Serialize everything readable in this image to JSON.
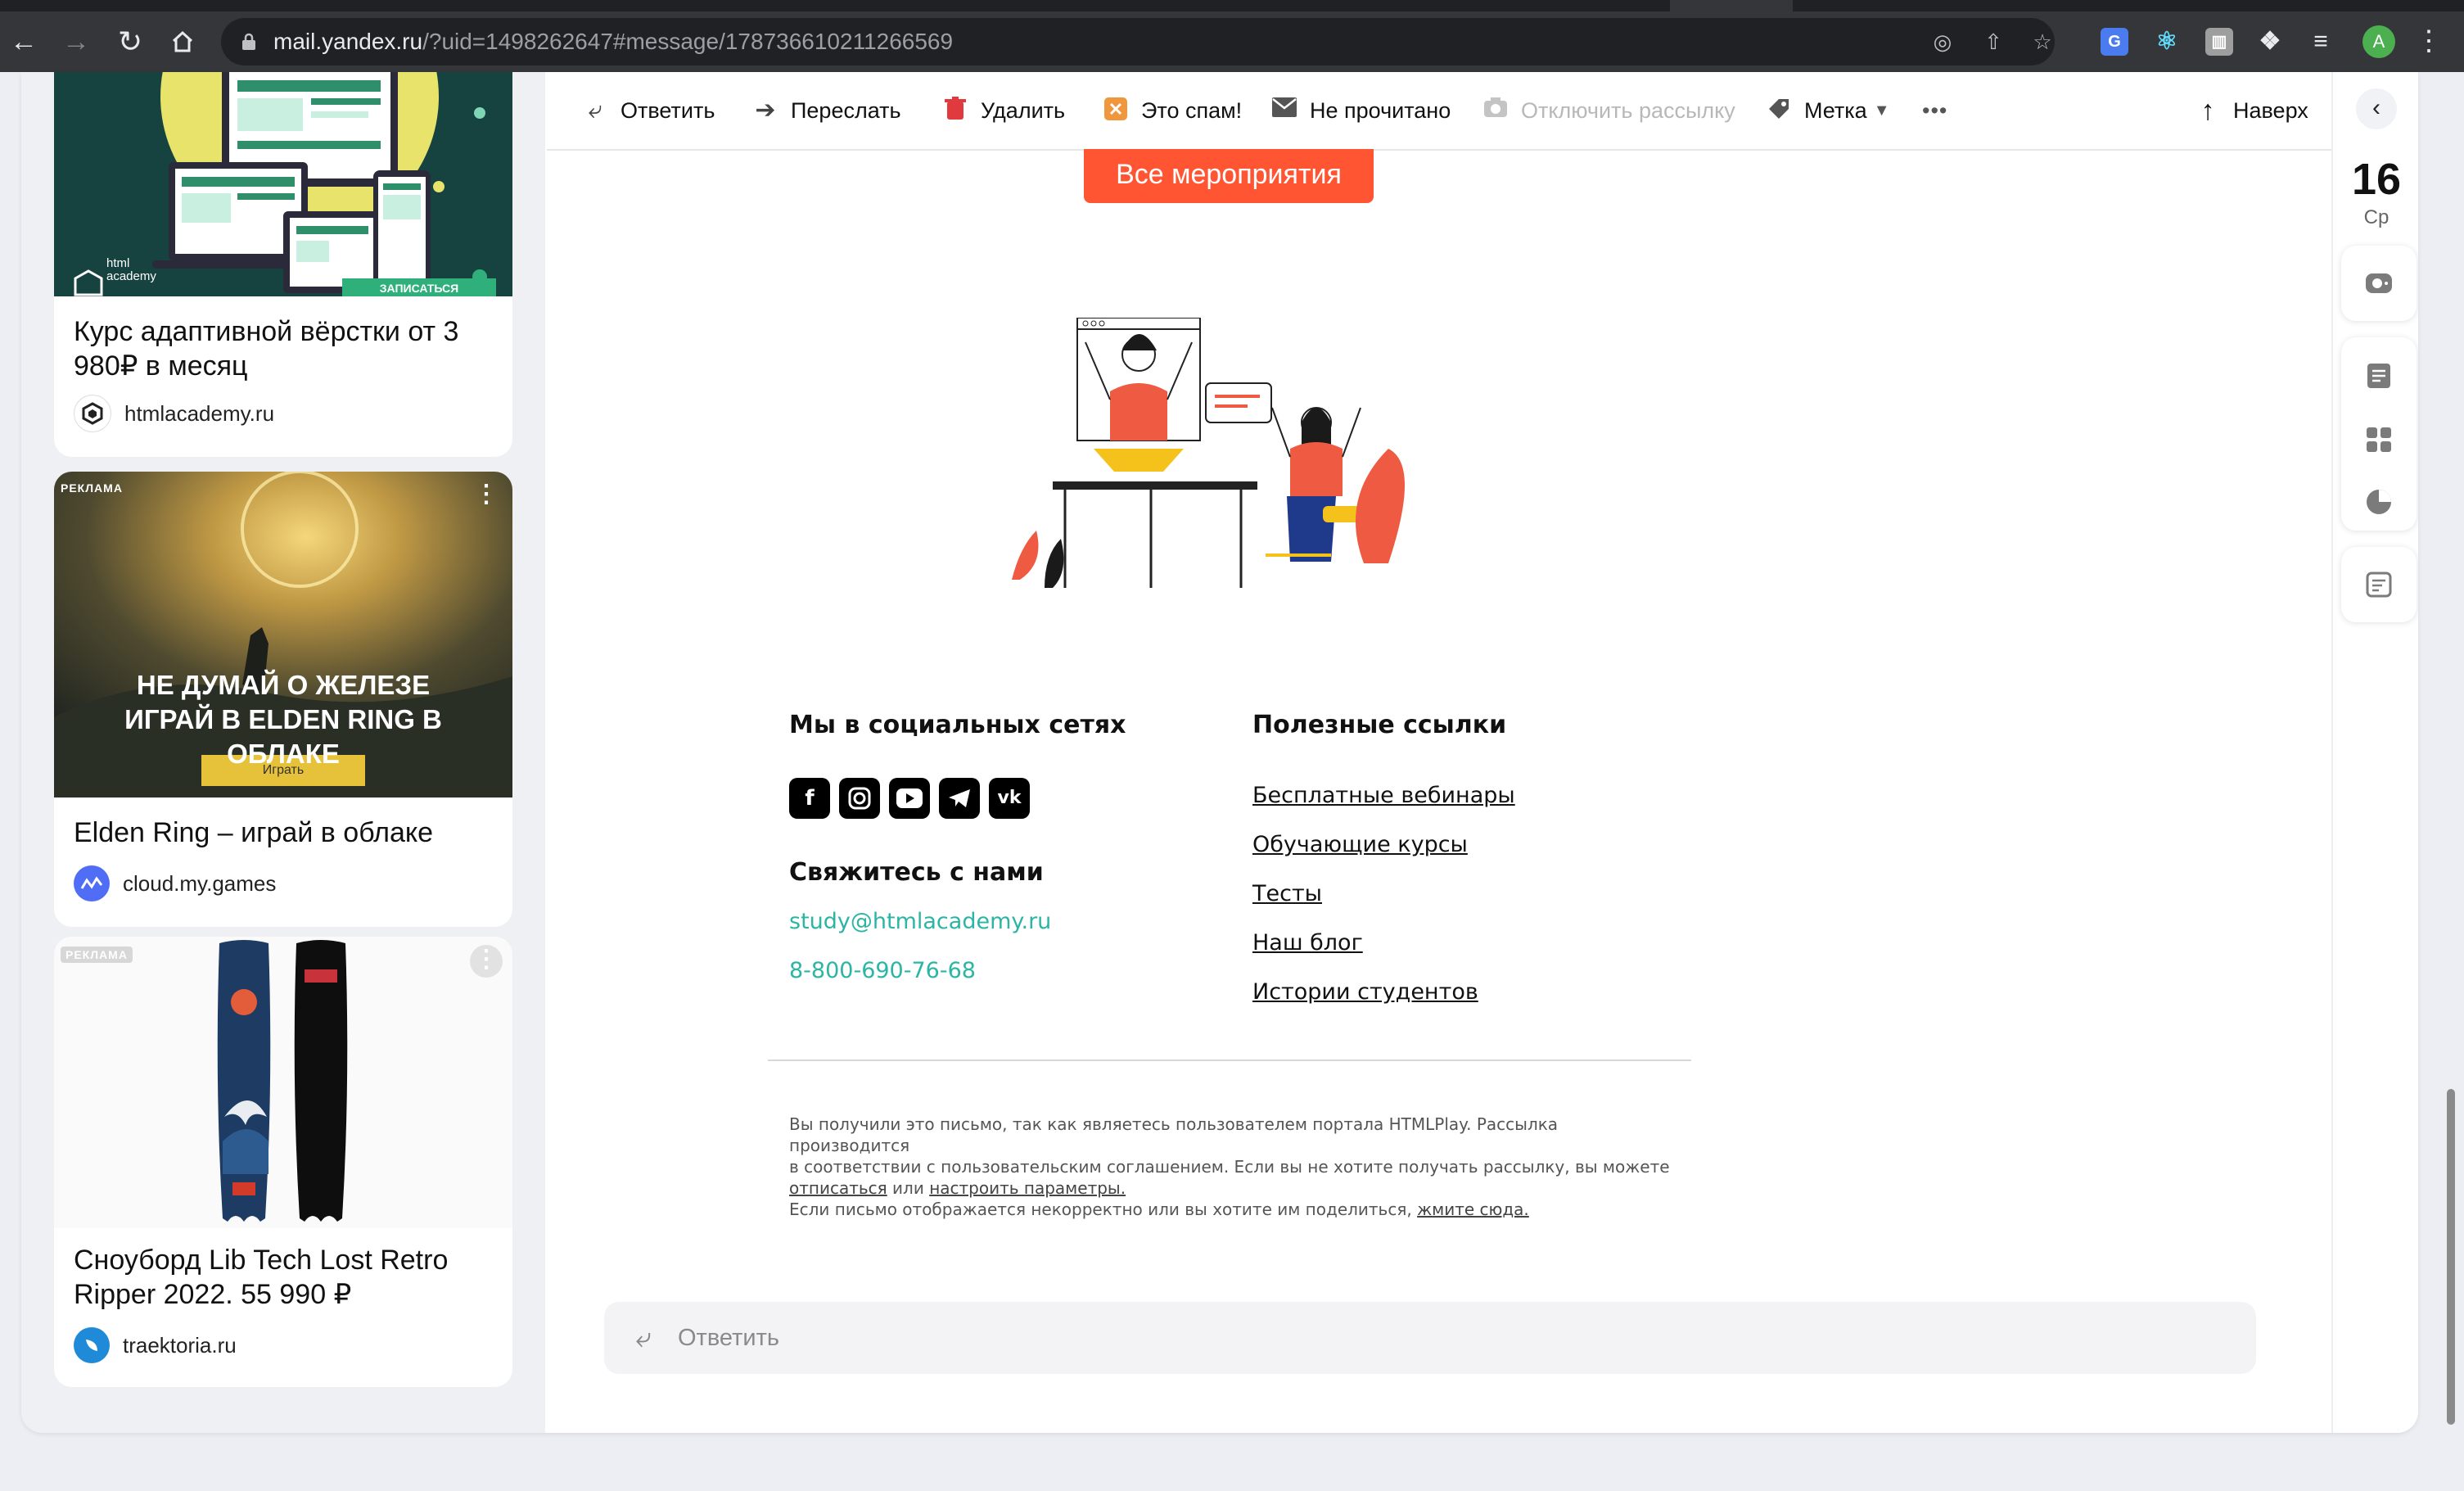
{
  "browser": {
    "url_host": "mail.yandex.ru",
    "url_rest": "/?uid=1498262647#message/178736610211266569",
    "avatar_letter": "A"
  },
  "toolbar": {
    "reply": "Ответить",
    "forward": "Переслать",
    "delete": "Удалить",
    "spam": "Это спам!",
    "unread": "Не прочитано",
    "unsubscribe": "Отключить рассылку",
    "label": "Метка",
    "more": "•••",
    "top": "Наверх"
  },
  "ads": [
    {
      "title": "Курс адаптивной вёрстки от 3 980₽ в месяц",
      "source": "htmlacademy.ru",
      "image_text": [
        "html",
        "academy",
        "ЗАПИСАТЬСЯ"
      ]
    },
    {
      "label": "РЕКЛАМА",
      "image_headline": "НЕ ДУМАЙ О ЖЕЛЕЗЕ ИГРАЙ В ELDEN RING В ОБЛАКЕ",
      "image_button": "Играть",
      "title": "Elden Ring – играй в облаке",
      "source": "cloud.my.games"
    },
    {
      "label": "РЕКЛАМА",
      "title": "Сноуборд Lib Tech Lost Retro Ripper 2022. 55 990 ₽",
      "source": "traektoria.ru"
    }
  ],
  "email": {
    "all_events_button": "Все мероприятия",
    "social_heading": "Мы в социальных сетях",
    "contact_heading": "Свяжитесь с нами",
    "email": "study@htmlacademy.ru",
    "phone": "8-800-690-76-68",
    "links_heading": "Полезные ссылки",
    "links": [
      "Бесплатные вебинары",
      "Обучающие курсы",
      "Тесты",
      "Наш блог",
      "Истории студентов"
    ],
    "footer_line1": "Вы получили это письмо, так как являетесь пользователем портала HTMLPlay. Рассылка производится",
    "footer_line2": "в соответствии с пользовательским соглашением. Если вы не хотите получать рассылку, вы можете",
    "footer_unsub": "отписаться",
    "footer_or": " или ",
    "footer_settings": "настроить параметры.",
    "footer2_text": "Если письмо отображается некорректно или вы хотите им поделиться, ",
    "footer2_link": "жмите сюда."
  },
  "reply_box": {
    "placeholder": "Ответить"
  },
  "calendar": {
    "day": "16",
    "weekday": "Ср"
  },
  "colors": {
    "accent_orange": "#ff5533",
    "link_teal": "#2bb5a4",
    "frame_bg": "#eceef4"
  }
}
